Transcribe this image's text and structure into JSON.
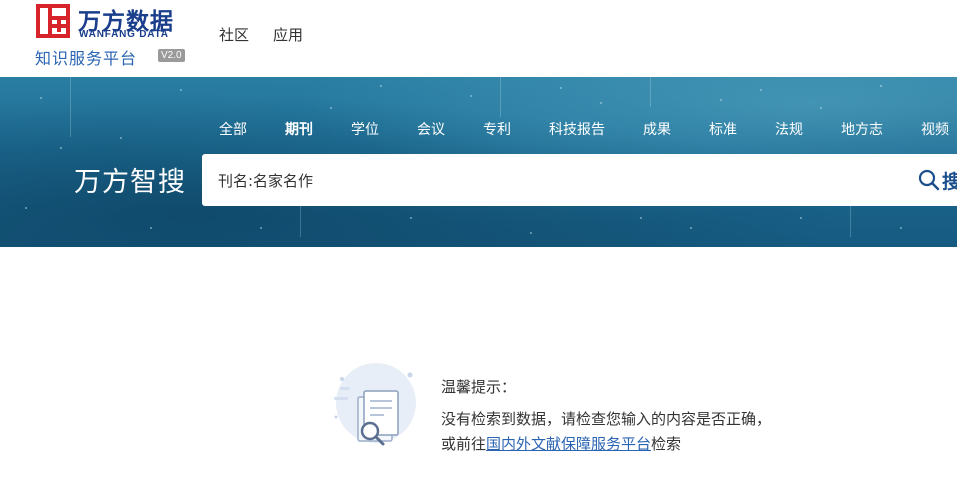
{
  "logo": {
    "name_cn": "万方数据",
    "name_en": "WANFANG DATA",
    "subtitle": "知识服务平台",
    "version": "V2.0"
  },
  "top_nav": [
    {
      "label": "社区"
    },
    {
      "label": "应用"
    }
  ],
  "search": {
    "brand": "万方智搜",
    "types": [
      {
        "label": "全部",
        "active": false
      },
      {
        "label": "期刊",
        "active": true
      },
      {
        "label": "学位",
        "active": false
      },
      {
        "label": "会议",
        "active": false
      },
      {
        "label": "专利",
        "active": false
      },
      {
        "label": "科技报告",
        "active": false
      },
      {
        "label": "成果",
        "active": false
      },
      {
        "label": "标准",
        "active": false
      },
      {
        "label": "法规",
        "active": false
      },
      {
        "label": "地方志",
        "active": false
      },
      {
        "label": "视频",
        "active": false
      }
    ],
    "query": "刊名:名家名作",
    "button_label": "搜"
  },
  "empty_result": {
    "title": "温馨提示：",
    "message": "没有检索到数据，请检查您输入的内容是否正确，",
    "suggest_prefix": "或前往",
    "suggest_link": "国内外文献保障服务平台",
    "suggest_suffix": "检索"
  },
  "colors": {
    "brand_red": "#d7232a",
    "brand_blue": "#1a3e8c",
    "link_blue": "#2a64b3"
  }
}
